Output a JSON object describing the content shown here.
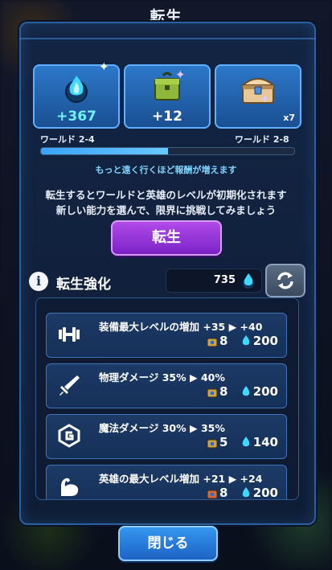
{
  "dialog": {
    "title": "転生"
  },
  "rewards": [
    {
      "amount": "+367",
      "icon": "blue-soul-flame-icon"
    },
    {
      "amount": "+12",
      "icon": "green-crate-icon"
    },
    {
      "amount": "x7",
      "icon": "treasure-chest-icon"
    }
  ],
  "progress": {
    "from_label": "ワールド 2-4",
    "to_label": "ワールド 2-8",
    "fill_fraction": 0.5
  },
  "hint": "もっと遠く行くほど報酬が増えます",
  "description": {
    "line1": "転生するとワールドと英雄のレベルが初期化されます",
    "line2": "新しい能力を選んで、限界に挑戦してみましょう"
  },
  "rebirth_button": "転生",
  "section": {
    "title": "転生強化",
    "currency_value": "735"
  },
  "upgrades": [
    {
      "name": "装備最大レベルの増加 +35 ▶ +40",
      "cost1": "8",
      "cost2": "200",
      "icon": "dumbbell-icon"
    },
    {
      "name": "物理ダメージ 35% ▶ 40%",
      "cost1": "8",
      "cost2": "200",
      "icon": "sword-icon"
    },
    {
      "name": "魔法ダメージ 30% ▶ 35%",
      "cost1": "5",
      "cost2": "140",
      "icon": "magic-rune-icon"
    },
    {
      "name": "英雄の最大レベル増加 +21 ▶ +24",
      "cost1": "8",
      "cost2": "200",
      "icon": "flexed-arm-icon"
    }
  ],
  "close_button": "閉じる",
  "colors": {
    "accent": "#2b5fa0",
    "purple": "#9b3bdc",
    "cyan": "#72f1ff"
  }
}
